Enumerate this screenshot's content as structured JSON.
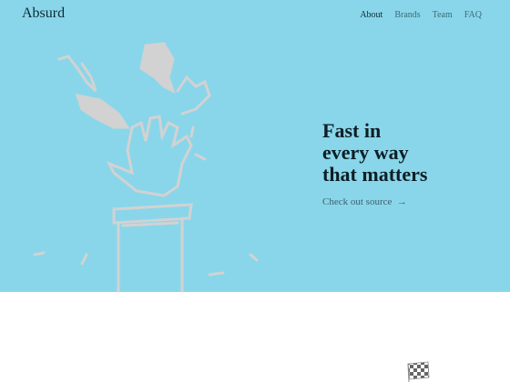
{
  "brand": {
    "logo": "Absurd"
  },
  "nav": {
    "items": [
      {
        "label": "About",
        "active": true
      },
      {
        "label": "Brands"
      },
      {
        "label": "Team"
      },
      {
        "label": "FAQ"
      }
    ]
  },
  "hero": {
    "headline_lines": [
      "Fast in",
      "every way",
      "that matters"
    ],
    "cta_label": "Check out source",
    "cta_icon": "arrow-right-icon",
    "background": "#89d6ea"
  },
  "decorations": {
    "illustration": "hands-on-pedestal-illustration",
    "flag": "checkered-flag-icon"
  }
}
